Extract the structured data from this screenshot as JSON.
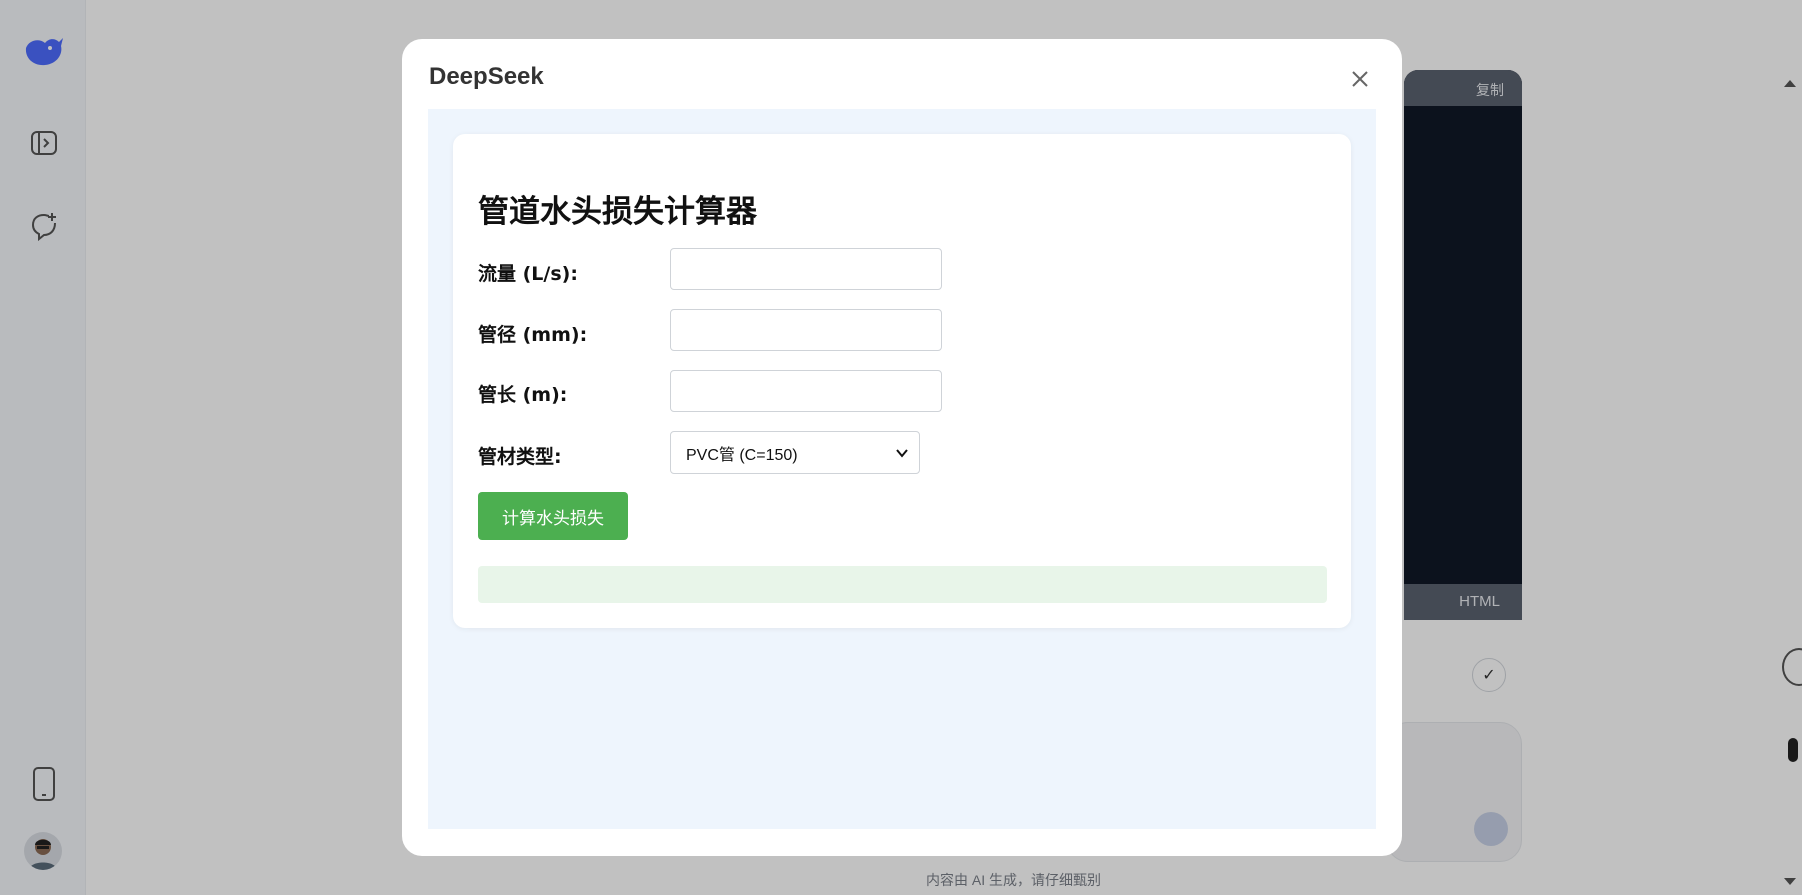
{
  "modal": {
    "title": "DeepSeek",
    "close_icon": "close-icon"
  },
  "calculator": {
    "title": "管道水头损失计算器",
    "fields": [
      {
        "label": "流量 (L/s):",
        "value": ""
      },
      {
        "label": "管径 (mm):",
        "value": ""
      },
      {
        "label": "管长 (m):",
        "value": ""
      }
    ],
    "material": {
      "label": "管材类型:",
      "selected": "PVC管 (C=150)"
    },
    "button_label": "计算水头损失",
    "result_text": ""
  },
  "background": {
    "sidebar_icons": [
      "deepseek-logo-icon",
      "sidebar-toggle-icon",
      "new-chat-icon",
      "phone-icon"
    ],
    "code_panel_header": "复制",
    "code_panel_footer": "HTML",
    "disclaimer": "内容由 AI 生成，请仔细甄别"
  },
  "colors": {
    "accent_button": "#4caf50",
    "result_bg": "#e8f5e9",
    "modal_body_bg": "#eef5fd",
    "brand_blue": "#4d6bfe"
  }
}
